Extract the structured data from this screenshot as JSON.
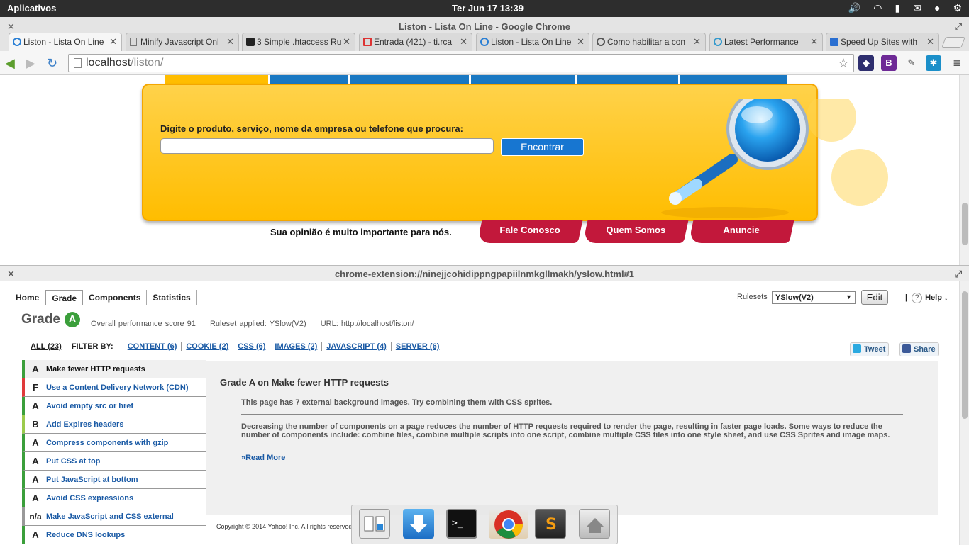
{
  "system_bar": {
    "apps_label": "Aplicativos",
    "clock": "Ter Jun 17 13:39",
    "tray_icons": [
      "volume-icon",
      "wifi-icon",
      "battery-icon",
      "mail-icon",
      "user-icon",
      "gear-icon"
    ]
  },
  "window": {
    "title": "Liston - Lista On Line - Google Chrome"
  },
  "tabs": [
    {
      "label": "Liston - Lista On Line",
      "icon": "liston-icon"
    },
    {
      "label": "Minify Javascript Onl",
      "icon": "page-icon"
    },
    {
      "label": "3 Simple .htaccess Ru",
      "icon": "r-icon"
    },
    {
      "label": "Entrada (421) - ti.rca",
      "icon": "gmail-icon"
    },
    {
      "label": "Liston - Lista On Line",
      "icon": "liston-icon"
    },
    {
      "label": "Como habilitar a con",
      "icon": "wordpress-icon"
    },
    {
      "label": "Latest Performance",
      "icon": "google-icon"
    },
    {
      "label": "Speed Up Sites with",
      "icon": "aa-icon"
    }
  ],
  "toolbar": {
    "url_host": "localhost",
    "url_path": "/liston/",
    "extensions": [
      "extension-1",
      "bookmarks-b-icon",
      "eyedropper-icon",
      "extension-blue",
      "menu-icon"
    ]
  },
  "site": {
    "search_label": "Digite o produto, serviço, nome da empresa ou telefone que procura:",
    "search_placeholder": "",
    "find_button": "Encontrar",
    "opinion_text": "Sua opinião é muito importante para nós.",
    "footer_tabs": [
      "Fale Conosco",
      "Quem Somos",
      "Anuncie"
    ]
  },
  "yslow": {
    "panel_title": "chrome-extension://ninejjcohidippngpapiilnmkgllmakh/yslow.html#1",
    "tabs": [
      "Home",
      "Grade",
      "Components",
      "Statistics"
    ],
    "active_tab": "Grade",
    "rulesets_label": "Rulesets",
    "ruleset_value": "YSlow(V2)",
    "edit_label": "Edit",
    "help_label": "Help ↓",
    "grade_heading": "Grade",
    "grade": "A",
    "score_text": "Overall performance score 91",
    "ruleset_applied": "Ruleset applied: YSlow(V2)",
    "url_text": "URL: http://localhost/liston/",
    "filter": {
      "all": "ALL (23)",
      "filter_by": "FILTER BY:",
      "items": [
        "CONTENT (6)",
        "COOKIE (2)",
        "CSS (6)",
        "IMAGES (2)",
        "JAVASCRIPT (4)",
        "SERVER (6)"
      ]
    },
    "tweet_label": "Tweet",
    "share_label": "Share",
    "rules": [
      {
        "grade": "A",
        "name": "Make fewer HTTP requests",
        "color": "#3b9f3b"
      },
      {
        "grade": "F",
        "name": "Use a Content Delivery Network (CDN)",
        "color": "#e03a3a"
      },
      {
        "grade": "A",
        "name": "Avoid empty src or href",
        "color": "#3b9f3b"
      },
      {
        "grade": "B",
        "name": "Add Expires headers",
        "color": "#9ccb4c"
      },
      {
        "grade": "A",
        "name": "Compress components with gzip",
        "color": "#3b9f3b"
      },
      {
        "grade": "A",
        "name": "Put CSS at top",
        "color": "#3b9f3b"
      },
      {
        "grade": "A",
        "name": "Put JavaScript at bottom",
        "color": "#3b9f3b"
      },
      {
        "grade": "A",
        "name": "Avoid CSS expressions",
        "color": "#3b9f3b"
      },
      {
        "grade": "n/a",
        "name": "Make JavaScript and CSS external",
        "color": "#999999"
      },
      {
        "grade": "A",
        "name": "Reduce DNS lookups",
        "color": "#3b9f3b"
      }
    ],
    "detail": {
      "title": "Grade A on Make fewer HTTP requests",
      "message": "This page has 7 external background images. Try combining them with CSS sprites.",
      "description": "Decreasing the number of components on a page reduces the number of HTTP requests required to render the page, resulting in faster page loads. Some ways to reduce the number of components include: combine files, combine multiple scripts into one script, combine multiple CSS files into one style sheet, and use CSS Sprites and image maps.",
      "read_more": "»Read More"
    },
    "copyright": "Copyright © 2014 Yahoo! Inc. All rights reserved."
  },
  "dock": [
    "workspace-switcher-icon",
    "download-icon",
    "terminal-icon",
    "chrome-icon",
    "sublime-text-icon",
    "home-folder-icon"
  ]
}
